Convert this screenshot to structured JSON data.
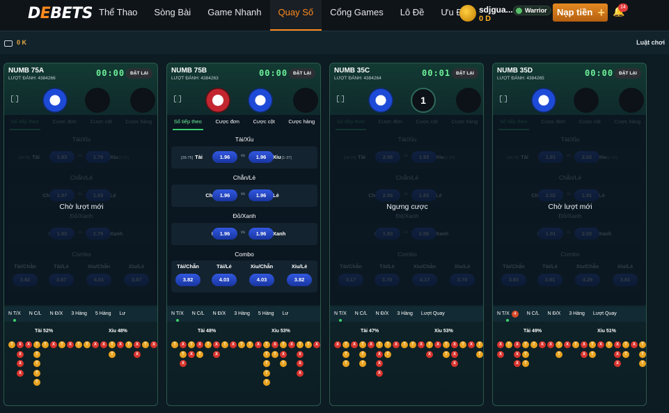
{
  "header": {
    "logo_main": "D",
    "logo_o": "E",
    "logo_rest": "BETS",
    "nav": [
      "Thể Thao",
      "Sòng Bài",
      "Game Nhanh",
      "Quay Số",
      "Cổng Games",
      "Lô Đề",
      "Ưu Đãi"
    ],
    "active_nav": "Quay Số",
    "username": "sdjgua...",
    "balance": "0 D",
    "rank": "Warrior",
    "deposit_label": "Nạp tiền",
    "notifications": "14"
  },
  "subbar": {
    "wallet_amount": "0 K",
    "rules_label": "Luật chơi"
  },
  "colors": {
    "accent": "#ff8a1c",
    "timer": "#6ef29a",
    "pill": "#2a4fd0",
    "tai": "#e8a21f",
    "xiu": "#d8332c"
  },
  "game_tabs": [
    "Số tiếp theo",
    "Cược đơn",
    "Cược cột",
    "Cược hàng"
  ],
  "sections": {
    "tai_xiu": "Tài/Xỉu",
    "chan_le": "Chẵn/Lẻ",
    "do_xanh": "Đỏ/Xanh",
    "combo": "Combo",
    "tai": "Tài",
    "xiu": "Xỉu",
    "tai_range": "[38-75]",
    "xiu_range": "[1-37]",
    "chan": "Chẵn",
    "le": "Lẻ",
    "do": "Đỏ",
    "xanh": "Xanh",
    "vs": "vs",
    "combo_labels": [
      "Tài/Chẵn",
      "Tài/Lẻ",
      "Xỉu/Chẵn",
      "Xỉu/Lẻ"
    ]
  },
  "panels": [
    {
      "title": "NUMB 75A",
      "count": "LƯỢT ĐÁNH: 4384266",
      "timer": "00:00",
      "reset": "ĐẶT LẠI",
      "overlay": "Chờ lượt mới",
      "odds": {
        "tai": "1.93",
        "xiu": "1.79",
        "chan": "1.97",
        "le": "1.93",
        "do": "1.93",
        "xanh": "1.79"
      },
      "combo_odds": [
        "3.82",
        "3.67",
        "4.01",
        "3.87"
      ],
      "bottom_tabs": [
        "N T/X",
        "N C/L",
        "N Đ/X",
        "3 Hàng",
        "5 Hàng",
        "Lư"
      ],
      "tai_pct": "Tài 52%",
      "xiu_pct": "Xỉu 48%"
    },
    {
      "title": "NUMB 75B",
      "count": "LƯỢT ĐÁNH: 4384263",
      "timer": "00:00",
      "reset": "ĐẶT LẠI",
      "overlay": "",
      "odds": {
        "tai": "1.96",
        "xiu": "1.96",
        "chan": "1.96",
        "le": "1.96",
        "do": "1.96",
        "xanh": "1.96"
      },
      "combo_odds": [
        "3.82",
        "4.03",
        "4.03",
        "3.82"
      ],
      "bottom_tabs": [
        "N T/X",
        "N C/L",
        "N Đ/X",
        "3 Hàng",
        "5 Hàng",
        "Lư"
      ],
      "tai_pct": "Tài 48%",
      "xiu_pct": "Xỉu 53%"
    },
    {
      "title": "NUMB 35C",
      "count": "LƯỢT ĐÁNH: 4384264",
      "timer": "00:01",
      "reset": "ĐẶT LẠI",
      "overlay": "Ngưng cược",
      "ball_number": "1",
      "odds": {
        "tai": "2.06",
        "xiu": "1.93",
        "chan": "2.06",
        "le": "1.83",
        "do": "1.83",
        "xanh": "2.06"
      },
      "combo_odds": [
        "3.17",
        "3.70",
        "4.17",
        "3.70"
      ],
      "bottom_tabs": [
        "N T/X",
        "N C/L",
        "N Đ/X",
        "3 Hàng",
        "Lượt Quay"
      ],
      "tai_pct": "Tài 47%",
      "xiu_pct": "Xỉu 53%"
    },
    {
      "title": "NUMB 35D",
      "count": "LƯỢT ĐÁNH: 4384265",
      "timer": "00:00",
      "reset": "ĐẶT LẠI",
      "overlay": "Chờ lượt mới",
      "odds": {
        "tai": "1.91",
        "xiu": "2.02",
        "chan": "2.02",
        "le": "1.91",
        "do": "1.91",
        "xanh": "2.02"
      },
      "combo_odds": [
        "3.81",
        "3.81",
        "4.29",
        "3.81"
      ],
      "bottom_tabs": [
        "N T/X",
        "N C/L",
        "N Đ/X",
        "3 Hàng",
        "Lượt Quay"
      ],
      "badge": "4",
      "tai_pct": "Tài 49%",
      "xiu_pct": "Xỉu 51%"
    }
  ],
  "roads": [
    [
      [
        "T"
      ],
      [
        "X",
        "X",
        "X",
        "X"
      ],
      [
        "X"
      ],
      [
        "T",
        "T",
        "T",
        "T",
        "T"
      ],
      [
        "T"
      ],
      [
        "X"
      ],
      [
        "T"
      ],
      [
        "X"
      ],
      [
        "T"
      ],
      [
        "T"
      ],
      [
        "X"
      ],
      [
        "X"
      ],
      [
        "T",
        "T"
      ],
      [
        "X"
      ],
      [
        "T"
      ],
      [
        "X",
        "X"
      ],
      [
        "T"
      ],
      [
        "X"
      ]
    ],
    [
      [
        "T"
      ],
      [
        "X",
        "T",
        "X"
      ],
      [
        "T",
        "X"
      ],
      [
        "X",
        "T"
      ],
      [
        "T"
      ],
      [
        "X",
        "X"
      ],
      [
        "T"
      ],
      [
        "X"
      ],
      [
        "T"
      ],
      [
        "T"
      ],
      [
        "X"
      ],
      [
        "T",
        "T",
        "T",
        "T",
        "T"
      ],
      [
        "X",
        "T"
      ],
      [
        "T",
        "X",
        "T"
      ],
      [
        "X"
      ],
      [
        "T",
        "X",
        "X",
        "X"
      ],
      [
        "T"
      ],
      [
        "X"
      ]
    ],
    [
      [
        "X"
      ],
      [
        "T",
        "T",
        "T"
      ],
      [
        "X"
      ],
      [
        "T",
        "T",
        "T"
      ],
      [
        "X"
      ],
      [
        "T",
        "X",
        "X",
        "X"
      ],
      [
        "T",
        "T"
      ],
      [
        "X"
      ],
      [
        "T"
      ],
      [
        "T"
      ],
      [
        "X"
      ],
      [
        "T",
        "X"
      ],
      [
        "X"
      ],
      [
        "T",
        "T"
      ],
      [
        "X",
        "X",
        "X"
      ],
      [
        "T"
      ],
      [
        "X"
      ],
      [
        "T",
        "T"
      ]
    ],
    [
      [
        "X",
        "X"
      ],
      [
        "T"
      ],
      [
        "X",
        "X",
        "X"
      ],
      [
        "T",
        "T",
        "T"
      ],
      [
        "T"
      ],
      [
        "X"
      ],
      [
        "X"
      ],
      [
        "T",
        "T"
      ],
      [
        "X"
      ],
      [
        "T"
      ],
      [
        "X",
        "X"
      ],
      [
        "T",
        "T"
      ],
      [
        "X"
      ],
      [
        "T"
      ],
      [
        "X",
        "X",
        "X"
      ],
      [
        "T",
        "T"
      ],
      [
        "X"
      ],
      [
        "T",
        "T",
        "T"
      ]
    ]
  ]
}
